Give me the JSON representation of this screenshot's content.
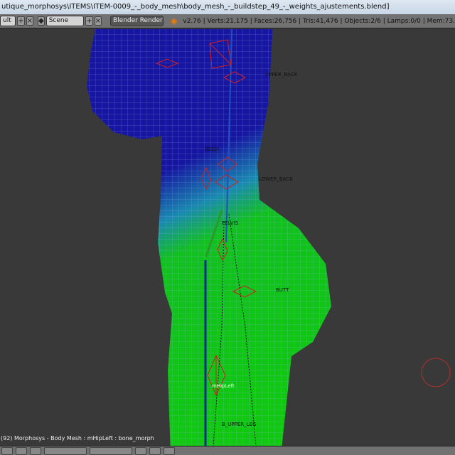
{
  "window": {
    "title": "utique_morphosys\\ITEMS\\ITEM-0009_-_body_mesh\\body_mesh_-_buildstep_49_-_weights_ajustements.blend]"
  },
  "header": {
    "layout_value": "ult",
    "scene_value": "Scene",
    "render_engine": "Blender Render",
    "stats": "v2.76 | Verts:21,175 | Faces:26,756 | Tris:41,476 | Objects:2/6 | Lamps:0/0 | Mem:73."
  },
  "viewport": {
    "bone_labels": {
      "upper_back": "UPPER_BACK",
      "belly": "BELLY",
      "lower_back": "LOWER_BACK",
      "pelvis": "PELVIS",
      "butt": "BUTT",
      "hip_left": "mHipLeft",
      "upper_leg": "B_UPPER_LEG"
    },
    "info": "(92) Morphosys - Body Mesh : mHipLeft : bone_morph"
  },
  "colors": {
    "mesh_blue": "#1414a0",
    "mesh_green": "#10c810",
    "bone_red": "#d02020"
  }
}
